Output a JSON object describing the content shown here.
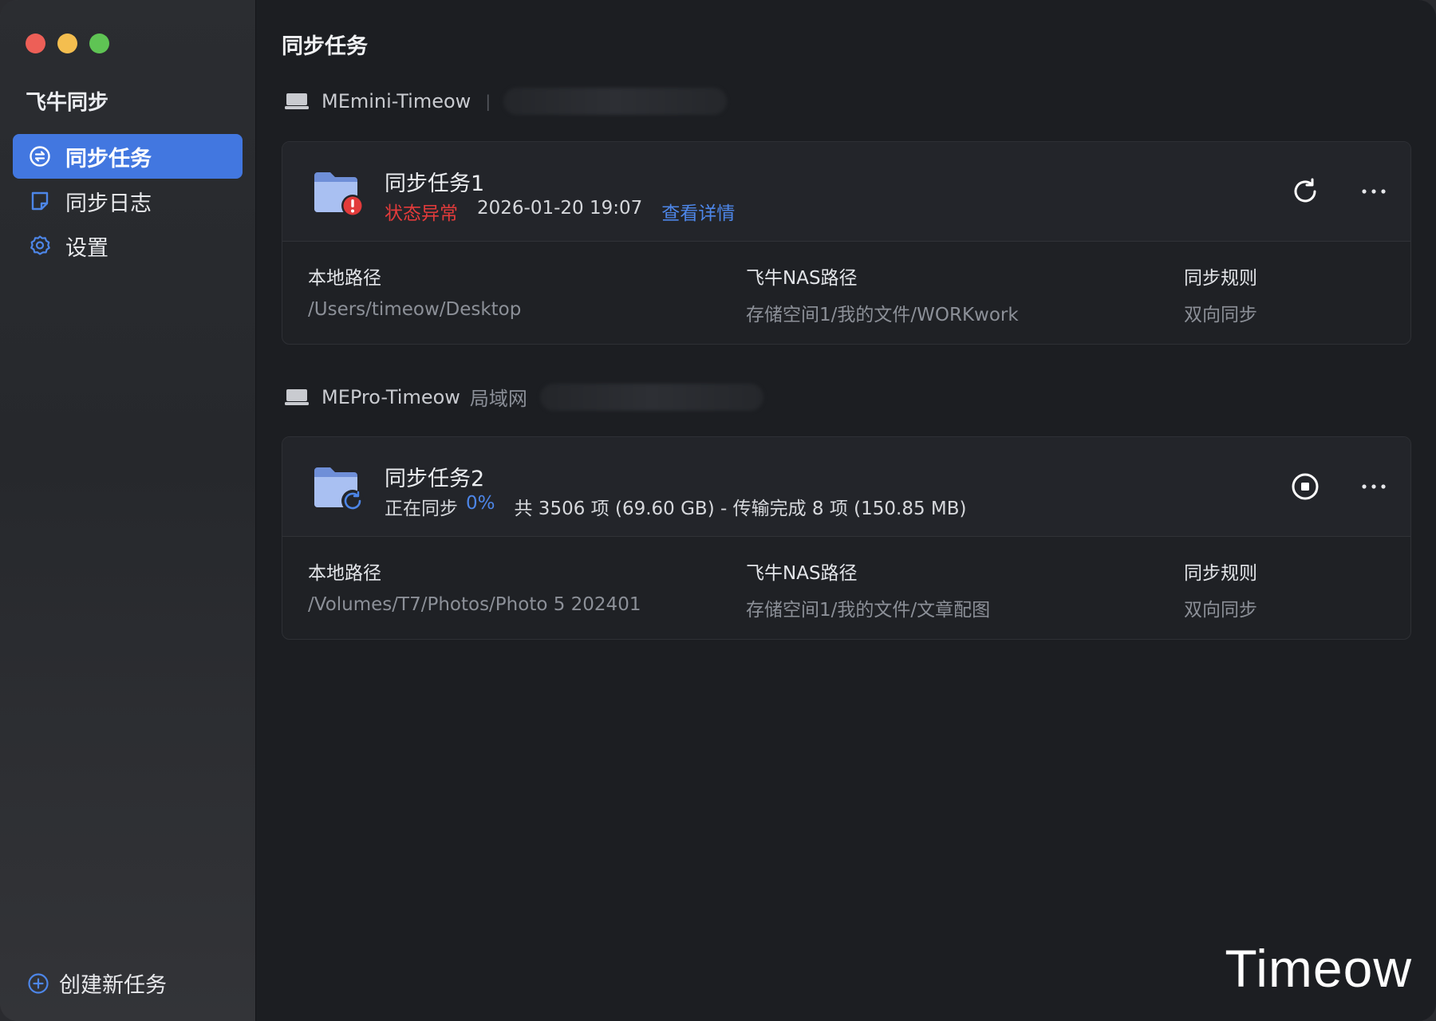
{
  "app": {
    "title": "飞牛同步"
  },
  "sidebar": {
    "items": [
      {
        "label": "同步任务",
        "icon": "sync-circle-icon",
        "active": true
      },
      {
        "label": "同步日志",
        "icon": "log-note-icon",
        "active": false
      },
      {
        "label": "设置",
        "icon": "gear-icon",
        "active": false
      }
    ],
    "create_label": "创建新任务"
  },
  "main": {
    "title": "同步任务",
    "devices": [
      {
        "name": "MEmini-Timeow",
        "tag": "",
        "separator": "|",
        "task": {
          "name": "同步任务1",
          "status": "状态异常",
          "time": "2026-01-20 19:07",
          "link": "查看详情",
          "local_label": "本地路径",
          "local_path": "/Users/timeow/Desktop",
          "nas_label": "飞牛NAS路径",
          "nas_path": "存储空间1/我的文件/WORKwork",
          "rule_label": "同步规则",
          "rule": "双向同步"
        }
      },
      {
        "name": "MEPro-Timeow",
        "tag": "局域网",
        "task": {
          "name": "同步任务2",
          "status": "正在同步",
          "progress": "0%",
          "summary": "共 3506 项 (69.60 GB) - 传输完成 8 项 (150.85 MB)",
          "local_label": "本地路径",
          "local_path": "/Volumes/T7/Photos/Photo 5 202401",
          "nas_label": "飞牛NAS路径",
          "nas_path": "存储空间1/我的文件/文章配图",
          "rule_label": "同步规则",
          "rule": "双向同步"
        }
      }
    ]
  },
  "watermark": "Timeow",
  "colors": {
    "accent": "#4277e0",
    "error": "#e23b3b",
    "link": "#4d86e8"
  }
}
